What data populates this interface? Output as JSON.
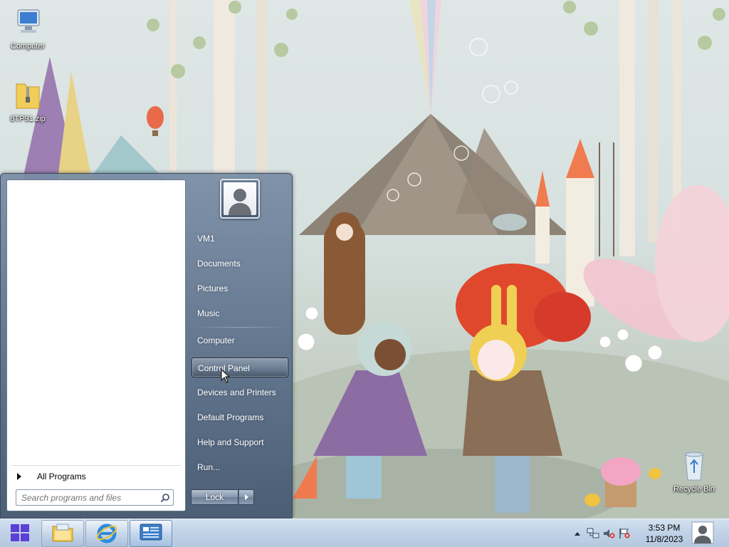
{
  "desktop": {
    "icons": [
      {
        "label": "Computer",
        "glyph": "computer-icon"
      },
      {
        "label": "8TP91.zip",
        "glyph": "zip-folder-icon"
      },
      {
        "label": "Recycle Bin",
        "glyph": "recycle-bin-icon"
      }
    ]
  },
  "start_menu": {
    "all_programs_label": "All Programs",
    "search_placeholder": "Search programs and files",
    "right_items": [
      {
        "label": "VM1"
      },
      {
        "label": "Documents"
      },
      {
        "label": "Pictures"
      },
      {
        "label": "Music"
      },
      {
        "label": "Computer"
      },
      {
        "label": "Control Panel",
        "selected": true
      },
      {
        "label": "Devices and Printers"
      },
      {
        "label": "Default Programs"
      },
      {
        "label": "Help and Support"
      },
      {
        "label": "Run..."
      }
    ],
    "lock_label": "Lock"
  },
  "taskbar": {
    "pinned": [
      "file-explorer-icon",
      "internet-explorer-icon",
      "server-manager-icon"
    ],
    "clock_time": "3:53 PM",
    "clock_date": "11/8/2023"
  },
  "colors": {
    "start_accent": "#5b3fd6",
    "taskbar": "#c3d4e8",
    "menu_glass": "#5c708a"
  }
}
